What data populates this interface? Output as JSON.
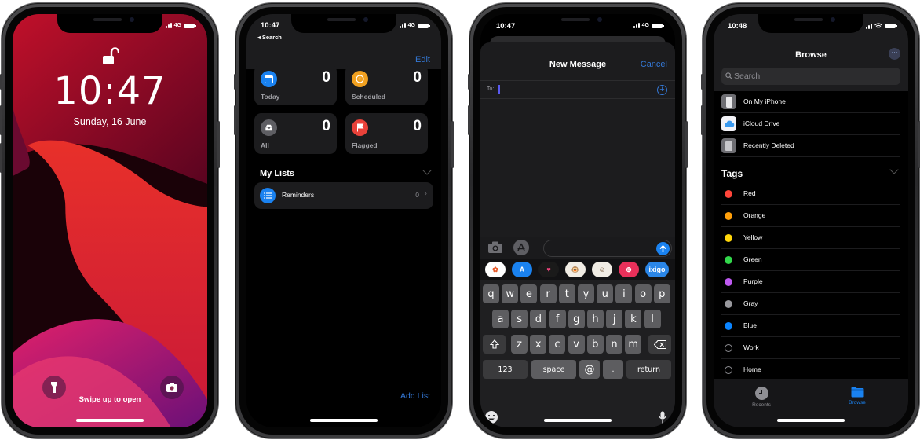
{
  "lock_screen": {
    "status": {
      "network": "4G"
    },
    "time": "10:47",
    "date": "Sunday, 16 June",
    "hint": "Swipe up to open",
    "icons": {
      "lock": "unlocked-padlock-icon",
      "flashlight": "flashlight-icon",
      "camera": "camera-icon"
    }
  },
  "reminders": {
    "status": {
      "time": "10:47",
      "back": "◂ Search",
      "network": "4G"
    },
    "edit_label": "Edit",
    "smart_lists": [
      {
        "label": "Today",
        "count": "0",
        "color": "#1a82f0",
        "icon": "calendar-icon"
      },
      {
        "label": "Scheduled",
        "count": "0",
        "color": "#f0a020",
        "icon": "clock-icon"
      },
      {
        "label": "All",
        "count": "0",
        "color": "#5e5e63",
        "icon": "tray-icon"
      },
      {
        "label": "Flagged",
        "count": "0",
        "color": "#e8423a",
        "icon": "flag-icon"
      }
    ],
    "my_lists_heading": "My Lists",
    "lists": [
      {
        "label": "Reminders",
        "count": "0",
        "color": "#1a82f0",
        "icon": "list-icon"
      }
    ],
    "add_list_label": "Add List"
  },
  "messages": {
    "status": {
      "time": "10:47",
      "network": "4G"
    },
    "title": "New Message",
    "cancel_label": "Cancel",
    "to_label": "To:",
    "to_value": "",
    "app_strip": [
      {
        "name": "photos-app-icon",
        "bg": "#ffffff",
        "glyph": "✿",
        "fg": "#e85a2a"
      },
      {
        "name": "app-store-icon",
        "bg": "#1a82f0",
        "glyph": "A",
        "fg": "#ffffff"
      },
      {
        "name": "digital-touch-icon",
        "bg": "#1a1a1a",
        "glyph": "♥",
        "fg": "#e8427a"
      },
      {
        "name": "animoji-icon",
        "bg": "#f0ece4",
        "glyph": "🐵",
        "fg": "#6a4a2a"
      },
      {
        "name": "memoji-icon",
        "bg": "#f0ece4",
        "glyph": "☺",
        "fg": "#6a4a2a"
      },
      {
        "name": "images-search-icon",
        "bg": "#e8305a",
        "glyph": "⊕",
        "fg": "#ffffff"
      },
      {
        "name": "ixigo-app-icon",
        "bg": "#2a86e8",
        "glyph": "ixigo",
        "fg": "#ffffff"
      }
    ],
    "keyboard": {
      "row1": [
        "q",
        "w",
        "e",
        "r",
        "t",
        "y",
        "u",
        "i",
        "o",
        "p"
      ],
      "row2": [
        "a",
        "s",
        "d",
        "f",
        "g",
        "h",
        "j",
        "k",
        "l"
      ],
      "row3": [
        "z",
        "x",
        "c",
        "v",
        "b",
        "n",
        "m"
      ],
      "numbers_key": "123",
      "space_key": "space",
      "at_key": "@",
      "period_key": ".",
      "return_key": "return"
    }
  },
  "files": {
    "status": {
      "time": "10:48"
    },
    "title": "Browse",
    "search_placeholder": "Search",
    "locations": [
      {
        "label": "On My iPhone",
        "icon": "iphone-icon",
        "bg": "#6e6e73"
      },
      {
        "label": "iCloud Drive",
        "icon": "icloud-icon",
        "bg": "#f2f2f7"
      },
      {
        "label": "Recently Deleted",
        "icon": "trash-icon",
        "bg": "#6e6e73"
      }
    ],
    "tags_heading": "Tags",
    "tags": [
      {
        "label": "Red",
        "color": "#ff453a"
      },
      {
        "label": "Orange",
        "color": "#ff9f0a"
      },
      {
        "label": "Yellow",
        "color": "#ffd60a"
      },
      {
        "label": "Green",
        "color": "#32d74b"
      },
      {
        "label": "Purple",
        "color": "#bf5af2"
      },
      {
        "label": "Gray",
        "color": "#98989d"
      },
      {
        "label": "Blue",
        "color": "#0a84ff"
      },
      {
        "label": "Work",
        "color": ""
      },
      {
        "label": "Home",
        "color": ""
      }
    ],
    "tabs": [
      {
        "label": "Recents",
        "active": false
      },
      {
        "label": "Browse",
        "active": true
      }
    ],
    "accent": "#1a82f0"
  }
}
